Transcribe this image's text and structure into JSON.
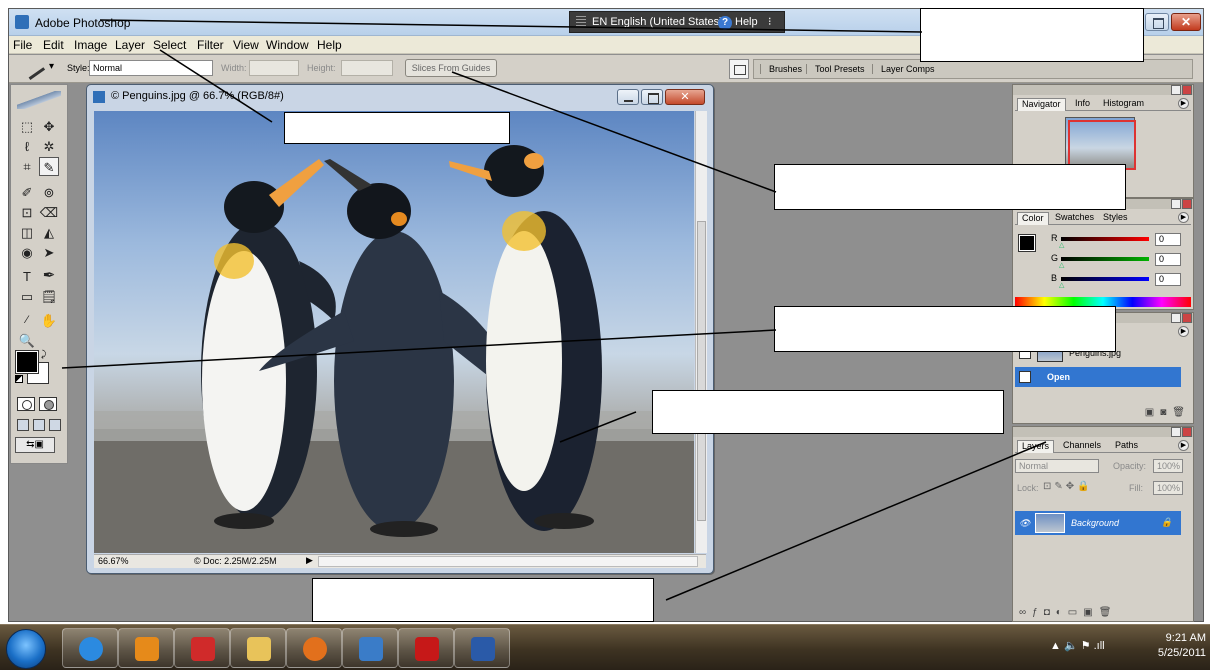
{
  "window": {
    "title": "Adobe Photoshop",
    "language_bar": {
      "language": "EN English (United States)",
      "help": "Help",
      "help_icon": "?",
      "more": "⁝"
    },
    "close_glyph": "✕"
  },
  "menu": [
    "File",
    "Edit",
    "Image",
    "Layer",
    "Select",
    "Filter",
    "View",
    "Window",
    "Help"
  ],
  "options_bar": {
    "style_label": "Style:",
    "style_value": "Normal",
    "width_label": "Width:",
    "height_label": "Height:",
    "slices_button": "Slices From Guides",
    "well_tabs": [
      "Brushes",
      "Tool Presets",
      "Layer Comps"
    ]
  },
  "toolbox": {
    "tools": [
      "⬚",
      "✥",
      "ℓ",
      "✲",
      "⌗",
      "✎",
      "✐",
      "⊚",
      "⊡",
      "⌫",
      "◫",
      "◭",
      "◉",
      "➤",
      "T",
      "✒",
      "▭",
      "🗒",
      "⁄",
      "✋",
      "🔍"
    ],
    "jump_label": "⇆▣"
  },
  "document": {
    "title": "© Penguins.jpg @ 66.7% (RGB/8#)",
    "close_glyph": "✕",
    "zoom": "66.67%",
    "doc_info": "© Doc: 2.25M/2.25M",
    "status_arrow": "▶"
  },
  "navigator": {
    "tabs": [
      "Navigator",
      "Info",
      "Histogram"
    ]
  },
  "color": {
    "tabs": [
      "Color",
      "Swatches",
      "Styles"
    ],
    "channels": [
      {
        "label": "R",
        "value": "0"
      },
      {
        "label": "G",
        "value": "0"
      },
      {
        "label": "B",
        "value": "0"
      }
    ]
  },
  "history": {
    "items": [
      {
        "label": "Penguins.jpg"
      },
      {
        "label": "Open"
      }
    ]
  },
  "layers": {
    "tabs": [
      "Layers",
      "Channels",
      "Paths"
    ],
    "blend_mode": "Normal",
    "opacity_label": "Opacity:",
    "opacity_value": "100%",
    "lock_label": "Lock:",
    "fill_label": "Fill:",
    "fill_value": "100%",
    "layer_name": "Background"
  },
  "taskbar": {
    "apps": [
      "explorer-ie-icon",
      "media-player-icon",
      "app-k-icon",
      "file-explorer-icon",
      "firefox-icon",
      "photoshop-icon",
      "acrobat-icon",
      "word-icon"
    ],
    "time": "9:21 AM",
    "date": "5/25/2011",
    "tray": "▲  🔈 ⚑ .ıll"
  },
  "colors": {
    "taskbar": "#3e3322",
    "selection": "#3276d0",
    "workspace": "#8f8f8f"
  }
}
